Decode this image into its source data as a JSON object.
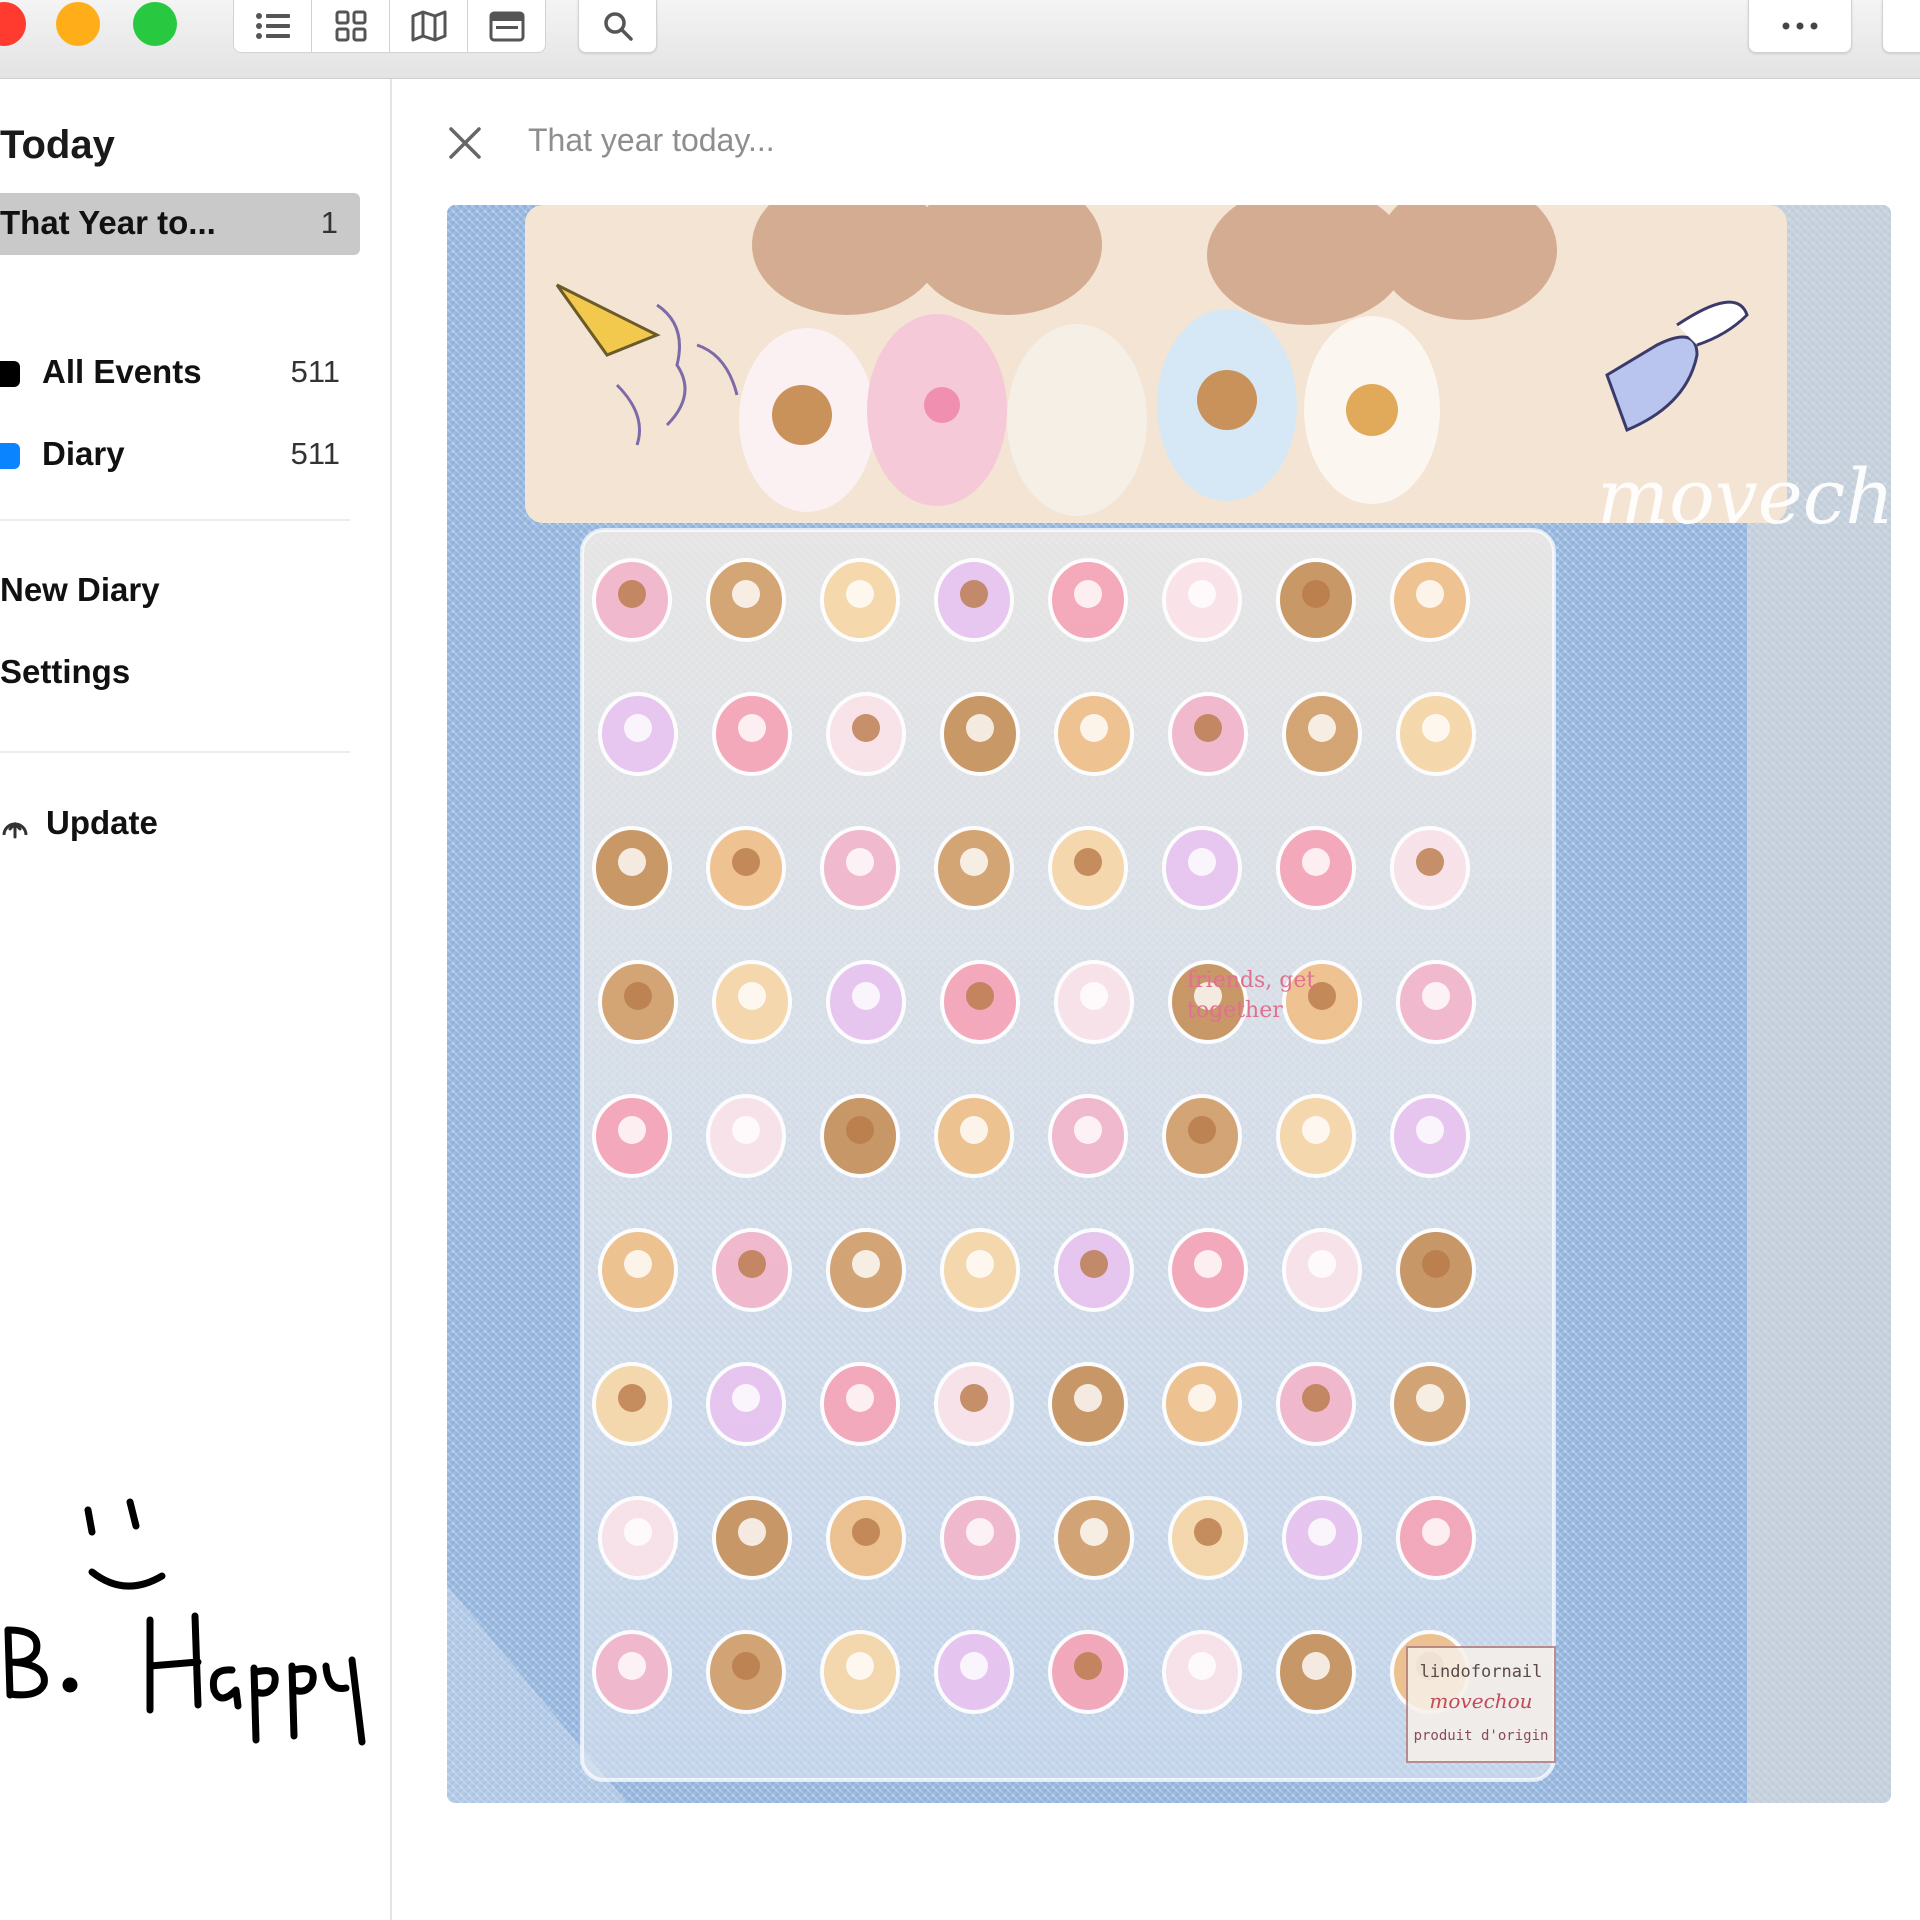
{
  "toolbar": {
    "traffic_lights": {
      "close": "#ff3b30",
      "minimize": "#ffae1a",
      "zoom": "#28c840"
    },
    "view_icons": [
      "list-icon",
      "grid-icon",
      "map-icon",
      "calendar-icon"
    ],
    "search_icon": "search-icon",
    "more_icon": "ellipsis-icon"
  },
  "sidebar": {
    "title": "Today",
    "selected": {
      "label": "That Year to...",
      "count": "1"
    },
    "calendars": [
      {
        "label": "All Events",
        "count": "511",
        "color": "#000000"
      },
      {
        "label": "Diary",
        "count": "511",
        "color": "#0a84ff"
      }
    ],
    "links": [
      "New Diary",
      "Settings"
    ],
    "update": {
      "label": "Update",
      "icon": "cloud-sync-icon"
    }
  },
  "doodle": {
    "text": "Be Happy",
    "face": "smiley"
  },
  "entry": {
    "title_placeholder": "That year today...",
    "close_icon": "close-icon",
    "photo": {
      "watermark": "movechou",
      "label_lines": [
        "lindofornail",
        "movechou",
        "produit d'origin"
      ],
      "sticker_text": [
        "friends, get",
        "together"
      ],
      "colors": {
        "denim": "#8fb1d9",
        "sheet": "#efe7dc",
        "sticker_pink": "#f0a8c4",
        "bear": "#c9925a"
      }
    }
  }
}
